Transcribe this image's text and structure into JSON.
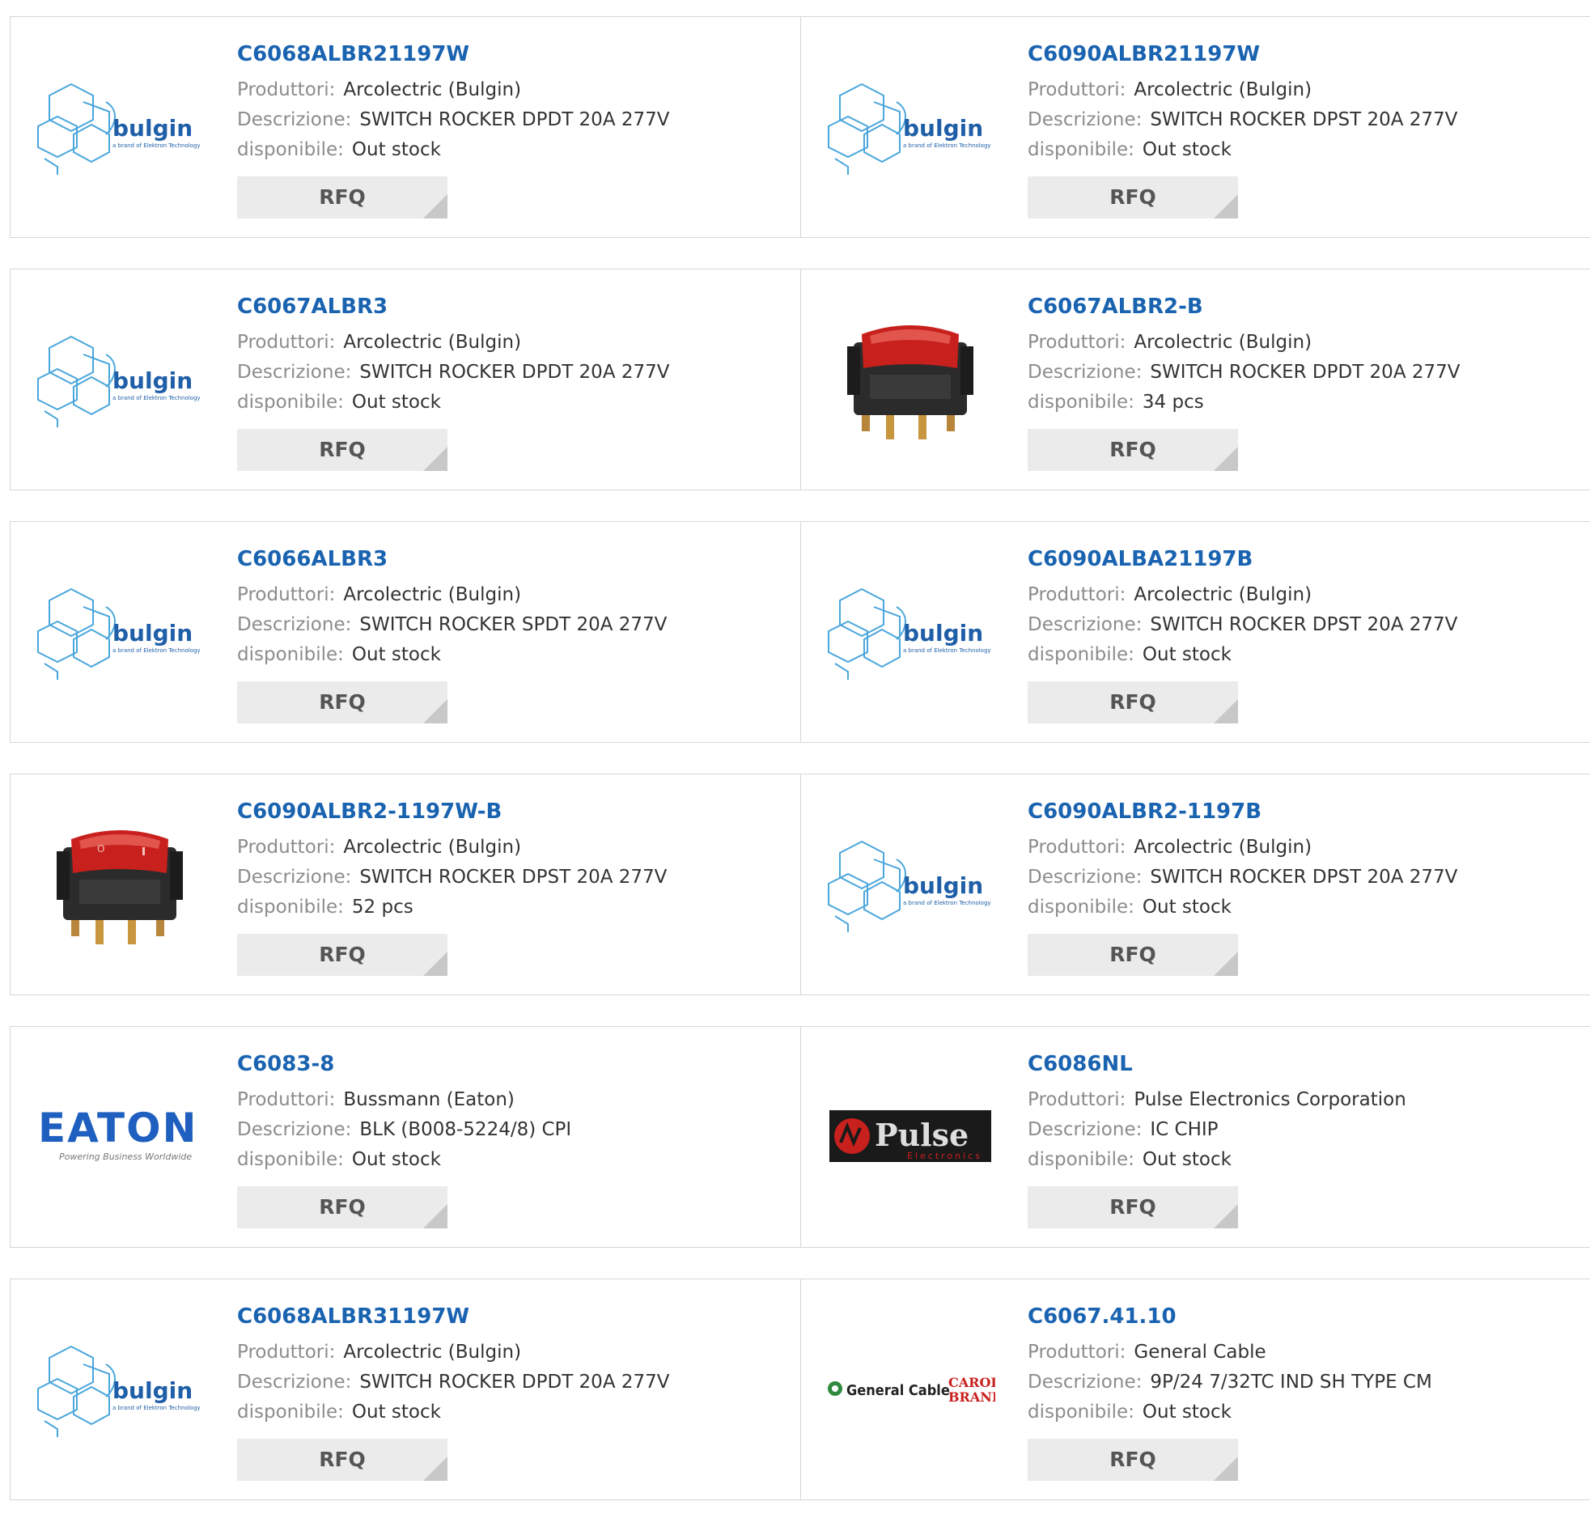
{
  "labels": {
    "manufacturer": "Produttori:",
    "description": "Descrizione:",
    "availability": "disponibile:",
    "rfq": "RFQ"
  },
  "logo_text": {
    "bulgin": "bulgin",
    "bulgin_tagline": "a brand of Elektron Technology",
    "eaton": "EATON",
    "eaton_tagline": "Powering Business Worldwide",
    "pulse": "Pulse",
    "pulse_sub": "Electronics",
    "general_cable": "General Cable",
    "carol": "CAROL",
    "brand": "BRAND"
  },
  "colors": {
    "part_link": "#1a63b0",
    "bulgin_blue": "#4aa6dc",
    "eaton_blue": "#1f5fbf",
    "switch_red": "#c8201d"
  },
  "products": [
    {
      "part": "C6068ALBR21197W",
      "manufacturer": "Arcolectric (Bulgin)",
      "description": "SWITCH ROCKER DPDT 20A 277V",
      "availability": "Out stock",
      "logo": "bulgin-logo"
    },
    {
      "part": "C6090ALBR21197W",
      "manufacturer": "Arcolectric (Bulgin)",
      "description": "SWITCH ROCKER DPST 20A 277V",
      "availability": "Out stock",
      "logo": "bulgin-logo"
    },
    {
      "part": "C6067ALBR3",
      "manufacturer": "Arcolectric (Bulgin)",
      "description": "SWITCH ROCKER DPDT 20A 277V",
      "availability": "Out stock",
      "logo": "bulgin-logo"
    },
    {
      "part": "C6067ALBR2-B",
      "manufacturer": "Arcolectric (Bulgin)",
      "description": "SWITCH ROCKER DPDT 20A 277V",
      "availability": "34 pcs",
      "logo": "rocker-switch-photo"
    },
    {
      "part": "C6066ALBR3",
      "manufacturer": "Arcolectric (Bulgin)",
      "description": "SWITCH ROCKER SPDT 20A 277V",
      "availability": "Out stock",
      "logo": "bulgin-logo"
    },
    {
      "part": "C6090ALBA21197B",
      "manufacturer": "Arcolectric (Bulgin)",
      "description": "SWITCH ROCKER DPST 20A 277V",
      "availability": "Out stock",
      "logo": "bulgin-logo"
    },
    {
      "part": "C6090ALBR2-1197W-B",
      "manufacturer": "Arcolectric (Bulgin)",
      "description": "SWITCH ROCKER DPST 20A 277V",
      "availability": "52 pcs",
      "logo": "rocker-switch-photo-marked"
    },
    {
      "part": "C6090ALBR2-1197B",
      "manufacturer": "Arcolectric (Bulgin)",
      "description": "SWITCH ROCKER DPST 20A 277V",
      "availability": "Out stock",
      "logo": "bulgin-logo"
    },
    {
      "part": "C6083-8",
      "manufacturer": "Bussmann (Eaton)",
      "description": "BLK (B008-5224/8) CPI",
      "availability": "Out stock",
      "logo": "eaton-logo"
    },
    {
      "part": "C6086NL",
      "manufacturer": "Pulse Electronics Corporation",
      "description": "IC CHIP",
      "availability": "Out stock",
      "logo": "pulse-logo"
    },
    {
      "part": "C6068ALBR31197W",
      "manufacturer": "Arcolectric (Bulgin)",
      "description": "SWITCH ROCKER DPDT 20A 277V",
      "availability": "Out stock",
      "logo": "bulgin-logo"
    },
    {
      "part": "C6067.41.10",
      "manufacturer": "General Cable",
      "description": "9P/24 7/32TC IND SH TYPE CM",
      "availability": "Out stock",
      "logo": "general-cable-logo"
    }
  ]
}
